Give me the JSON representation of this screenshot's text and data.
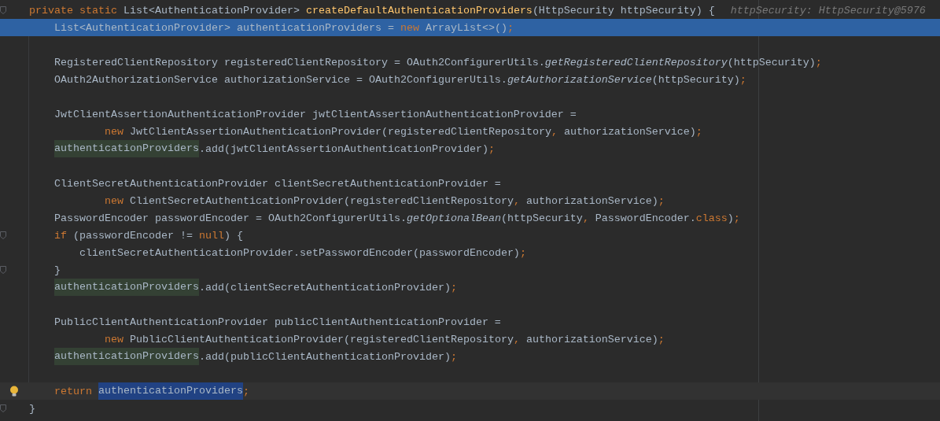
{
  "editor": {
    "lines": [
      {
        "kind": "outer",
        "marker": {
          "kind": "fold"
        },
        "current": false,
        "caret": false,
        "tokens": [
          {
            "text": "private static ",
            "kind": "keyword"
          },
          {
            "text": "List<AuthenticationProvider> ",
            "kind": "plain"
          },
          {
            "text": "createDefaultAuthenticationProviders",
            "kind": "method"
          },
          {
            "text": "(HttpSecurity httpSecurity) {",
            "kind": "plain"
          },
          {
            "text": "httpSecurity: HttpSecurity@5976",
            "kind": "hint"
          }
        ]
      },
      {
        "kind": "body",
        "current": true,
        "caret": false,
        "tokens": [
          {
            "text": "List<AuthenticationProvider> authenticationProviders = ",
            "kind": "plain"
          },
          {
            "text": "new",
            "kind": "keyword"
          },
          {
            "text": " ArrayList<>()",
            "kind": "plain"
          },
          {
            "text": ";",
            "kind": "punct"
          }
        ]
      },
      {
        "kind": "blank",
        "current": false,
        "caret": false
      },
      {
        "kind": "body",
        "current": false,
        "caret": false,
        "tokens": [
          {
            "text": "RegisteredClientRepository registeredClientRepository = OAuth2ConfigurerUtils.",
            "kind": "plain"
          },
          {
            "text": "getRegisteredClientRepository",
            "kind": "static"
          },
          {
            "text": "(httpSecurity)",
            "kind": "plain"
          },
          {
            "text": ";",
            "kind": "punct"
          }
        ]
      },
      {
        "kind": "body",
        "current": false,
        "caret": false,
        "tokens": [
          {
            "text": "OAuth2AuthorizationService authorizationService = OAuth2ConfigurerUtils.",
            "kind": "plain"
          },
          {
            "text": "getAuthorizationService",
            "kind": "static"
          },
          {
            "text": "(httpSecurity)",
            "kind": "plain"
          },
          {
            "text": ";",
            "kind": "punct"
          }
        ]
      },
      {
        "kind": "blank",
        "current": false,
        "caret": false
      },
      {
        "kind": "body",
        "current": false,
        "caret": false,
        "tokens": [
          {
            "text": "JwtClientAssertionAuthenticationProvider jwtClientAssertionAuthenticationProvider =",
            "kind": "plain"
          }
        ]
      },
      {
        "kind": "wrapped",
        "current": false,
        "caret": false,
        "tokens": [
          {
            "text": "new",
            "kind": "keyword"
          },
          {
            "text": " JwtClientAssertionAuthenticationProvider(registeredClientRepository",
            "kind": "plain"
          },
          {
            "text": ",",
            "kind": "punct"
          },
          {
            "text": " authorizationService)",
            "kind": "plain"
          },
          {
            "text": ";",
            "kind": "punct"
          }
        ]
      },
      {
        "kind": "body",
        "current": false,
        "caret": false,
        "tokens": [
          {
            "text": "authenticationProviders",
            "kind": "usage"
          },
          {
            "text": ".add(jwtClientAssertionAuthenticationProvider)",
            "kind": "plain"
          },
          {
            "text": ";",
            "kind": "punct"
          }
        ]
      },
      {
        "kind": "blank",
        "current": false,
        "caret": false
      },
      {
        "kind": "body",
        "current": false,
        "caret": false,
        "tokens": [
          {
            "text": "ClientSecretAuthenticationProvider clientSecretAuthenticationProvider =",
            "kind": "plain"
          }
        ]
      },
      {
        "kind": "wrapped",
        "current": false,
        "caret": false,
        "tokens": [
          {
            "text": "new",
            "kind": "keyword"
          },
          {
            "text": " ClientSecretAuthenticationProvider(registeredClientRepository",
            "kind": "plain"
          },
          {
            "text": ",",
            "kind": "punct"
          },
          {
            "text": " authorizationService)",
            "kind": "plain"
          },
          {
            "text": ";",
            "kind": "punct"
          }
        ]
      },
      {
        "kind": "body",
        "current": false,
        "caret": false,
        "tokens": [
          {
            "text": "PasswordEncoder passwordEncoder = OAuth2ConfigurerUtils.",
            "kind": "plain"
          },
          {
            "text": "getOptionalBean",
            "kind": "static"
          },
          {
            "text": "(httpSecurity",
            "kind": "plain"
          },
          {
            "text": ",",
            "kind": "punct"
          },
          {
            "text": " PasswordEncoder.",
            "kind": "plain"
          },
          {
            "text": "class",
            "kind": "keyword"
          },
          {
            "text": ")",
            "kind": "plain"
          },
          {
            "text": ";",
            "kind": "punct"
          }
        ]
      },
      {
        "kind": "body",
        "marker": {
          "kind": "fold"
        },
        "current": false,
        "caret": false,
        "tokens": [
          {
            "text": "if",
            "kind": "keyword"
          },
          {
            "text": " (passwordEncoder != ",
            "kind": "plain"
          },
          {
            "text": "null",
            "kind": "keyword"
          },
          {
            "text": ") {",
            "kind": "plain"
          }
        ]
      },
      {
        "kind": "inner",
        "current": false,
        "caret": false,
        "tokens": [
          {
            "text": "clientSecretAuthenticationProvider.setPasswordEncoder(passwordEncoder)",
            "kind": "plain"
          },
          {
            "text": ";",
            "kind": "punct"
          }
        ]
      },
      {
        "kind": "body",
        "marker": {
          "kind": "fold"
        },
        "current": false,
        "caret": false,
        "tokens": [
          {
            "text": "}",
            "kind": "plain"
          }
        ]
      },
      {
        "kind": "body",
        "current": false,
        "caret": false,
        "tokens": [
          {
            "text": "authenticationProviders",
            "kind": "usage"
          },
          {
            "text": ".add(clientSecretAuthenticationProvider)",
            "kind": "plain"
          },
          {
            "text": ";",
            "kind": "punct"
          }
        ]
      },
      {
        "kind": "blank",
        "current": false,
        "caret": false
      },
      {
        "kind": "body",
        "current": false,
        "caret": false,
        "tokens": [
          {
            "text": "PublicClientAuthenticationProvider publicClientAuthenticationProvider =",
            "kind": "plain"
          }
        ]
      },
      {
        "kind": "wrapped",
        "current": false,
        "caret": false,
        "tokens": [
          {
            "text": "new",
            "kind": "keyword"
          },
          {
            "text": " PublicClientAuthenticationProvider(registeredClientRepository",
            "kind": "plain"
          },
          {
            "text": ",",
            "kind": "punct"
          },
          {
            "text": " authorizationService)",
            "kind": "plain"
          },
          {
            "text": ";",
            "kind": "punct"
          }
        ]
      },
      {
        "kind": "body",
        "current": false,
        "caret": false,
        "tokens": [
          {
            "text": "authenticationProviders",
            "kind": "usage"
          },
          {
            "text": ".add(publicClientAuthenticationProvider)",
            "kind": "plain"
          },
          {
            "text": ";",
            "kind": "punct"
          }
        ]
      },
      {
        "kind": "blank",
        "current": false,
        "caret": false
      },
      {
        "kind": "body",
        "marker": {
          "kind": "bulb"
        },
        "current": false,
        "caret": true,
        "tokens": [
          {
            "text": "return",
            "kind": "keyword"
          },
          {
            "text": "authenticationProviders",
            "kind": "selection"
          },
          {
            "text": ";",
            "kind": "punct"
          }
        ]
      },
      {
        "kind": "outer",
        "marker": {
          "kind": "fold"
        },
        "current": false,
        "caret": false,
        "tokens": [
          {
            "text": "}",
            "kind": "plain"
          }
        ]
      }
    ]
  }
}
